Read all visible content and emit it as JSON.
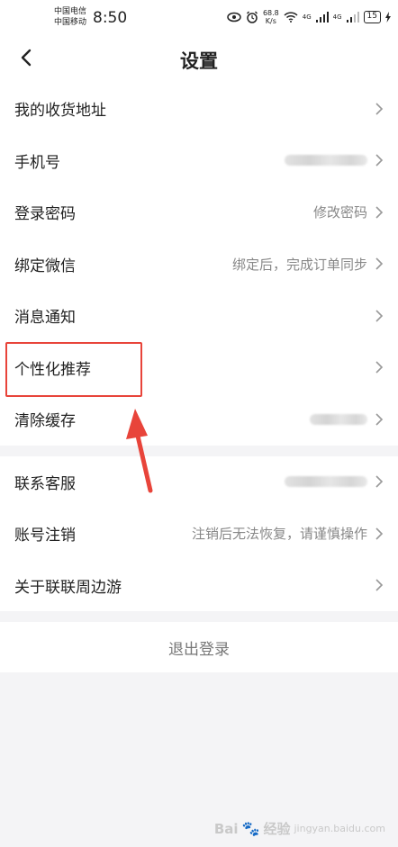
{
  "status_bar": {
    "carrier_1": "中国电信",
    "carrier_2": "中国移动",
    "time": "8:50",
    "net_speed_value": "68.8",
    "net_speed_unit": "K/s",
    "signal_1_label": "4G",
    "signal_2_label": "4G",
    "battery": "15"
  },
  "header": {
    "title": "设置"
  },
  "settings_group_1": [
    {
      "label": "我的收货地址",
      "value": "",
      "blurred": false
    },
    {
      "label": "手机号",
      "value": "",
      "blurred": true
    },
    {
      "label": "登录密码",
      "value": "修改密码",
      "blurred": false
    },
    {
      "label": "绑定微信",
      "value": "绑定后，完成订单同步",
      "blurred": false
    },
    {
      "label": "消息通知",
      "value": "",
      "blurred": false
    },
    {
      "label": "个性化推荐",
      "value": "",
      "blurred": false
    },
    {
      "label": "清除缓存",
      "value": "",
      "blurred": true
    }
  ],
  "settings_group_2": [
    {
      "label": "联系客服",
      "value": "",
      "blurred": true
    },
    {
      "label": "账号注销",
      "value": "注销后无法恢复，请谨慎操作",
      "blurred": false
    },
    {
      "label": "关于联联周边游",
      "value": "",
      "blurred": false
    }
  ],
  "logout": {
    "label": "退出登录"
  },
  "annotation": {
    "color": "#e8443a"
  },
  "watermark": {
    "brand": "Bai",
    "brand_suffix": "经验",
    "site": "jingyan.baidu.com"
  }
}
